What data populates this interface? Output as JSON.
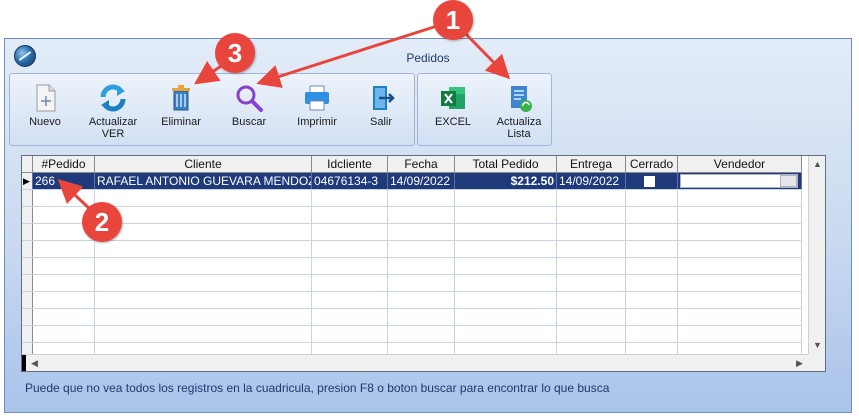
{
  "window": {
    "title": "Pedidos"
  },
  "toolbar": {
    "nuevo": "Nuevo",
    "actualizar_ver_1": "Actualizar",
    "actualizar_ver_2": "VER",
    "eliminar": "Eliminar",
    "buscar": "Buscar",
    "imprimir": "Imprimir",
    "salir": "Salir",
    "excel": "EXCEL",
    "actualiza_lista_1": "Actualiza",
    "actualiza_lista_2": "Lista"
  },
  "grid": {
    "columns": [
      "#Pedido",
      "Cliente",
      "Idcliente",
      "Fecha",
      "Total Pedido",
      "Entrega",
      "Cerrado",
      "Vendedor"
    ],
    "rows": [
      {
        "pedido": "266",
        "cliente": "RAFAEL ANTONIO GUEVARA MENDOZ",
        "idcliente": "04676134-3",
        "fecha": "14/09/2022",
        "total": "$212.50",
        "entrega": "14/09/2022",
        "cerrado": false,
        "vendedor": ""
      }
    ]
  },
  "status_text": "Puede que no vea todos los registros en la cuadricula, presion F8 o boton buscar para encontrar lo que busca",
  "annotations": {
    "a1": "1",
    "a2": "2",
    "a3": "3"
  },
  "colors": {
    "accent": "#e8453c",
    "selection": "#1e3a7a"
  }
}
